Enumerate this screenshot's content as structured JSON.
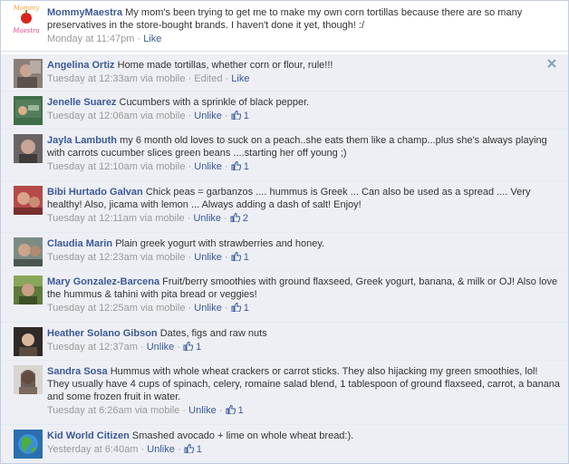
{
  "comments": [
    {
      "name": "MommyMaestra",
      "text": "My mom's been trying to get me to make my own corn tortillas because there are so many preservatives in the store-bought brands. I haven't done it yet, though! :/",
      "time": "Monday at 11:47pm",
      "via": "",
      "edited": "",
      "action": "Like",
      "likes": "",
      "logo_text": "Mommy Maestra",
      "logo_colors": {
        "mommy": "#f2a33a",
        "maestra": "#e8468a",
        "apple": "#d9231f"
      }
    },
    {
      "name": "Angelina Ortiz",
      "text": "Home made tortillas, whether corn or flour, rule!!!",
      "time": "Tuesday at 12:33am",
      "via": "via mobile",
      "edited": "Edited",
      "action": "Like",
      "likes": ""
    },
    {
      "name": "Jenelle Suarez",
      "text": "Cucumbers with a sprinkle of black pepper.",
      "time": "Tuesday at 12:06am",
      "via": "via mobile",
      "edited": "",
      "action": "Unlike",
      "likes": "1"
    },
    {
      "name": "Jayla Lambuth",
      "text": "my 6 month old loves to suck on a peach..she eats them like a champ...plus she's always playing with carrots cucumber slices green beans ....starting her off young ;)",
      "time": "Tuesday at 12:10am",
      "via": "via mobile",
      "edited": "",
      "action": "Unlike",
      "likes": "1"
    },
    {
      "name": "Bibi Hurtado Galvan",
      "text": "Chick peas = garbanzos .... hummus is Greek ... Can also be used as a spread .... Very healthy! Also, jicama with lemon ... Always adding a dash of salt! Enjoy!",
      "time": "Tuesday at 12:11am",
      "via": "via mobile",
      "edited": "",
      "action": "Unlike",
      "likes": "2"
    },
    {
      "name": "Claudia Marin",
      "text": "Plain greek yogurt with strawberries and honey.",
      "time": "Tuesday at 12:23am",
      "via": "via mobile",
      "edited": "",
      "action": "Unlike",
      "likes": "1"
    },
    {
      "name": "Mary Gonzalez-Barcena",
      "text": "Fruit/berry smoothies with ground flaxseed, Greek yogurt, banana, & milk or OJ! Also love the hummus & tahini with pita bread or veggies!",
      "time": "Tuesday at 12:25am",
      "via": "via mobile",
      "edited": "",
      "action": "Unlike",
      "likes": "1"
    },
    {
      "name": "Heather Solano Gibson",
      "text": "Dates, figs and raw nuts",
      "time": "Tuesday at 12:37am",
      "via": "",
      "edited": "",
      "action": "Unlike",
      "likes": "1"
    },
    {
      "name": "Sandra Sosa",
      "text": "Hummus with whole wheat crackers or carrot sticks. They also hijacking my green smoothies, lol! They usually have 4 cups of spinach, celery, romaine salad blend, 1 tablespoon of ground flaxseed, carrot, a banana and some frozen fruit in water.",
      "time": "Tuesday at 6:26am",
      "via": "via mobile",
      "edited": "",
      "action": "Unlike",
      "likes": "1"
    },
    {
      "name": "Kid World Citizen",
      "text": "Smashed avocado + lime on whole wheat bread:).",
      "time": "Yesterday at 6:40am",
      "via": "",
      "edited": "",
      "action": "Unlike",
      "likes": "1"
    }
  ],
  "colors": {
    "link": "#3b5998",
    "meta": "#999999",
    "row_bg": "#edeff4",
    "border": "#c4cde0"
  }
}
